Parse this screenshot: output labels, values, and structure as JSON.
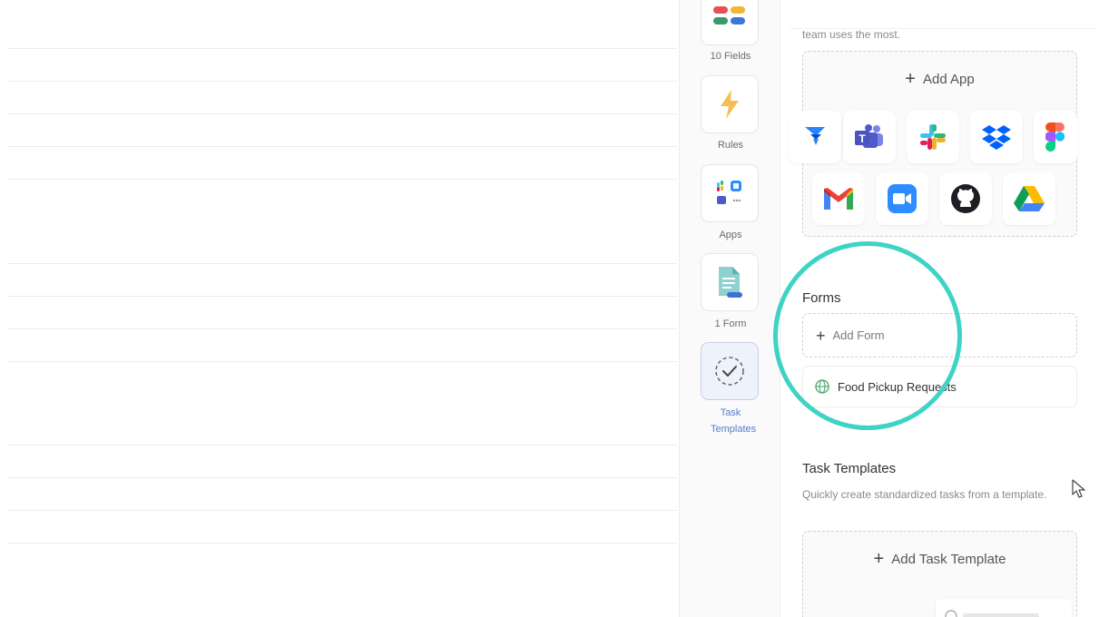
{
  "rail": {
    "items": [
      {
        "label": "10 Fields",
        "icon": "fields-grid-icon"
      },
      {
        "label": "Rules",
        "icon": "lightning-icon"
      },
      {
        "label": "Apps",
        "icon": "apps-cluster-icon"
      },
      {
        "label": "1 Form",
        "icon": "form-document-icon"
      },
      {
        "label": "Task Templates",
        "icon": "task-template-check-icon",
        "active": true
      }
    ]
  },
  "apps_section": {
    "desc_tail": "team uses the most.",
    "add_label": "Add App",
    "apps_row1": [
      "Jira",
      "Microsoft Teams",
      "Slack",
      "Dropbox",
      "Figma"
    ],
    "apps_row2": [
      "Gmail",
      "Zoom",
      "GitHub",
      "Google Drive"
    ]
  },
  "forms_section": {
    "title": "Forms",
    "add_label": "Add Form",
    "items": [
      {
        "label": "Food Pickup Requests",
        "icon": "globe-icon"
      }
    ]
  },
  "task_templates_section": {
    "title": "Task Templates",
    "desc": "Quickly create standardized tasks from a template.",
    "add_label": "Add Task Template"
  },
  "colors": {
    "highlight_ring": "#3fd3c6",
    "active_rail": "#eef2fb",
    "accent": "#5a7bc8"
  }
}
